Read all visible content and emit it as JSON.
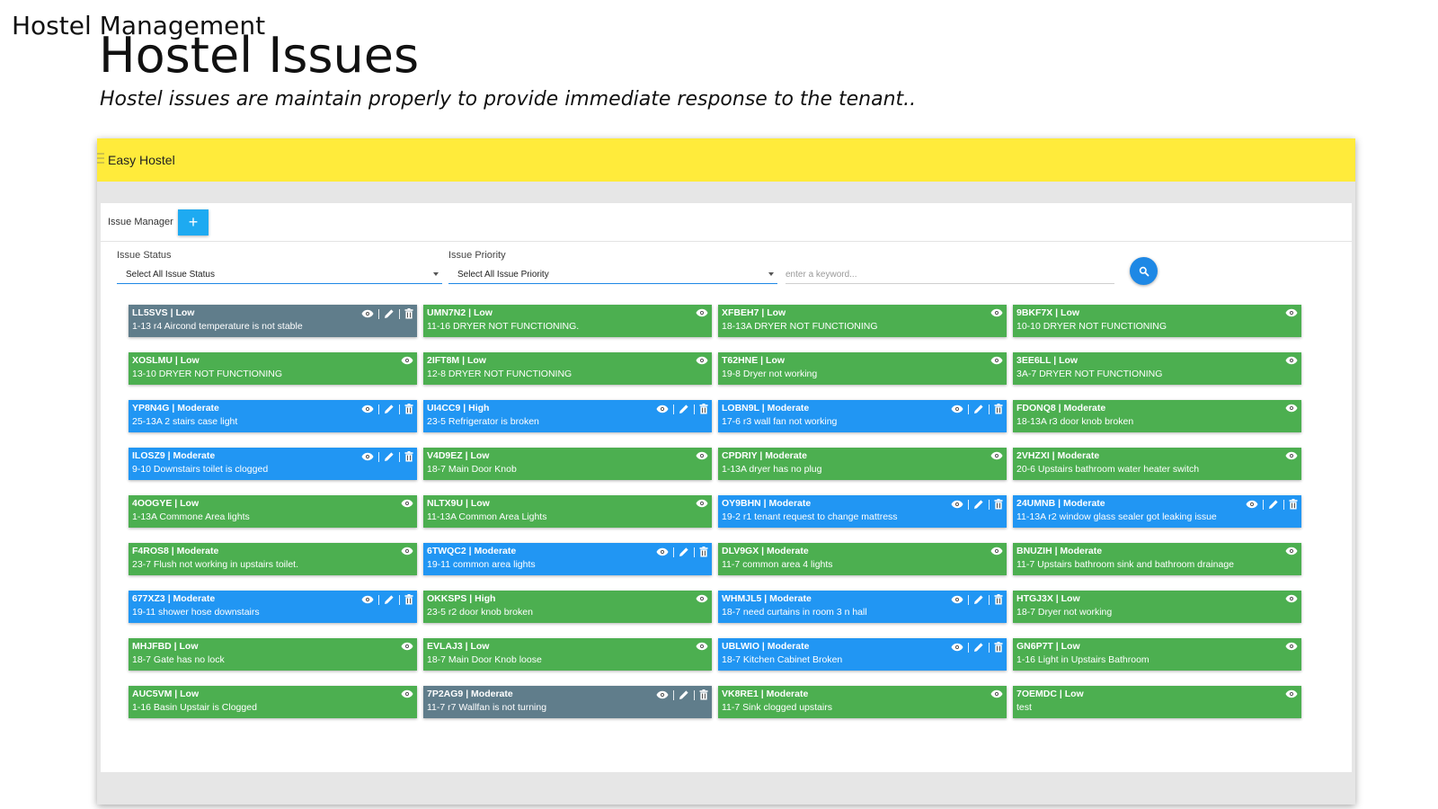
{
  "slide": {
    "kicker": "Hostel Management",
    "title": "Hostel Issues",
    "subtitle": "Hostel issues are maintain properly to provide immediate response to the tenant.."
  },
  "app": {
    "title": "Easy Hostel",
    "header_color": "#ffeb3b",
    "panel_label": "Issue Manager",
    "add_label": "+",
    "filters": {
      "status_label": "Issue Status",
      "status_value": "Select All Issue Status",
      "priority_label": "Issue Priority",
      "priority_value": "Select All Issue Priority",
      "keyword_placeholder": "enter a keyword..."
    }
  },
  "colors": {
    "low": "#4caf50",
    "moderate": "#2196f3",
    "grey": "#607d8b",
    "accent": "#1e88e5"
  },
  "issues": [
    {
      "head": "LL5SVS | Low",
      "desc": "1-13 r4 Aircond temperature is not stable",
      "color": "grey",
      "actions": [
        "eye",
        "edit",
        "delete"
      ]
    },
    {
      "head": "UMN7N2 | Low",
      "desc": "11-16 DRYER NOT FUNCTIONING.",
      "color": "low",
      "actions": [
        "eye"
      ]
    },
    {
      "head": "XFBEH7 | Low",
      "desc": "18-13A DRYER NOT FUNCTIONING",
      "color": "low",
      "actions": [
        "eye"
      ]
    },
    {
      "head": "9BKF7X | Low",
      "desc": "10-10 DRYER NOT FUNCTIONING",
      "color": "low",
      "actions": [
        "eye"
      ]
    },
    {
      "head": "XOSLMU | Low",
      "desc": "13-10 DRYER NOT FUNCTIONING",
      "color": "low",
      "actions": [
        "eye"
      ]
    },
    {
      "head": "2IFT8M | Low",
      "desc": "12-8 DRYER NOT FUNCTIONING",
      "color": "low",
      "actions": [
        "eye"
      ]
    },
    {
      "head": "T62HNE | Low",
      "desc": "19-8 Dryer not working",
      "color": "low",
      "actions": [
        "eye"
      ]
    },
    {
      "head": "3EE6LL | Low",
      "desc": "3A-7 DRYER NOT FUNCTIONING",
      "color": "low",
      "actions": [
        "eye"
      ]
    },
    {
      "head": "YP8N4G | Moderate",
      "desc": "25-13A 2 stairs case light",
      "color": "mod",
      "actions": [
        "eye",
        "edit",
        "delete"
      ]
    },
    {
      "head": "UI4CC9 | High",
      "desc": "23-5 Refrigerator is broken",
      "color": "mod",
      "actions": [
        "eye",
        "edit",
        "delete"
      ]
    },
    {
      "head": "LOBN9L | Moderate",
      "desc": "17-6 r3 wall fan not working",
      "color": "mod",
      "actions": [
        "eye",
        "edit",
        "delete"
      ]
    },
    {
      "head": "FDONQ8 | Moderate",
      "desc": "18-13A r3 door knob broken",
      "color": "low",
      "actions": [
        "eye"
      ]
    },
    {
      "head": "ILOSZ9 | Moderate",
      "desc": "9-10 Downstairs toilet is clogged",
      "color": "mod",
      "actions": [
        "eye",
        "edit",
        "delete"
      ]
    },
    {
      "head": "V4D9EZ | Low",
      "desc": "18-7 Main Door Knob",
      "color": "low",
      "actions": [
        "eye"
      ]
    },
    {
      "head": "CPDRIY | Moderate",
      "desc": "1-13A dryer has no plug",
      "color": "low",
      "actions": [
        "eye"
      ]
    },
    {
      "head": "2VHZXI | Moderate",
      "desc": "20-6 Upstairs bathroom water heater switch",
      "color": "low",
      "actions": [
        "eye"
      ]
    },
    {
      "head": "4OOGYE | Low",
      "desc": "1-13A Commone Area lights",
      "color": "low",
      "actions": [
        "eye"
      ]
    },
    {
      "head": "NLTX9U | Low",
      "desc": "11-13A Common Area Lights",
      "color": "low",
      "actions": [
        "eye"
      ]
    },
    {
      "head": "OY9BHN | Moderate",
      "desc": "19-2 r1 tenant request to change mattress",
      "color": "mod",
      "actions": [
        "eye",
        "edit",
        "delete"
      ]
    },
    {
      "head": "24UMNB | Moderate",
      "desc": "11-13A r2 window glass sealer got leaking issue",
      "color": "mod",
      "actions": [
        "eye",
        "edit",
        "delete"
      ]
    },
    {
      "head": "F4ROS8 | Moderate",
      "desc": "23-7 Flush not working in upstairs toilet.",
      "color": "low",
      "actions": [
        "eye"
      ]
    },
    {
      "head": "6TWQC2 | Moderate",
      "desc": "19-11 common area lights",
      "color": "mod",
      "actions": [
        "eye",
        "edit",
        "delete"
      ]
    },
    {
      "head": "DLV9GX | Moderate",
      "desc": "11-7 common area 4 lights",
      "color": "low",
      "actions": [
        "eye"
      ]
    },
    {
      "head": "BNUZIH | Moderate",
      "desc": "11-7 Upstairs bathroom sink and bathroom drainage",
      "color": "low",
      "actions": [
        "eye"
      ]
    },
    {
      "head": "677XZ3 | Moderate",
      "desc": "19-11 shower hose downstairs",
      "color": "mod",
      "actions": [
        "eye",
        "edit",
        "delete"
      ]
    },
    {
      "head": "OKKSPS | High",
      "desc": "23-5 r2 door knob broken",
      "color": "low",
      "actions": [
        "eye"
      ]
    },
    {
      "head": "WHMJL5 | Moderate",
      "desc": "18-7 need curtains in room 3 n hall",
      "color": "mod",
      "actions": [
        "eye",
        "edit",
        "delete"
      ]
    },
    {
      "head": "HTGJ3X | Low",
      "desc": "18-7 Dryer not working",
      "color": "low",
      "actions": [
        "eye"
      ]
    },
    {
      "head": "MHJFBD | Low",
      "desc": "18-7 Gate has no lock",
      "color": "low",
      "actions": [
        "eye"
      ]
    },
    {
      "head": "EVLAJ3 | Low",
      "desc": "18-7 Main Door Knob loose",
      "color": "low",
      "actions": [
        "eye"
      ]
    },
    {
      "head": "UBLWIO | Moderate",
      "desc": "18-7 Kitchen Cabinet Broken",
      "color": "mod",
      "actions": [
        "eye",
        "edit",
        "delete"
      ]
    },
    {
      "head": "GN6P7T | Low",
      "desc": "1-16 Light in Upstairs Bathroom",
      "color": "low",
      "actions": [
        "eye"
      ]
    },
    {
      "head": "AUC5VM | Low",
      "desc": "1-16 Basin Upstair is Clogged",
      "color": "low",
      "actions": [
        "eye"
      ]
    },
    {
      "head": "7P2AG9 | Moderate",
      "desc": "11-7 r7 Wallfan is not turning",
      "color": "grey",
      "actions": [
        "eye",
        "edit",
        "delete"
      ]
    },
    {
      "head": "VK8RE1 | Moderate",
      "desc": "11-7 Sink clogged upstairs",
      "color": "low",
      "actions": [
        "eye"
      ]
    },
    {
      "head": "7OEMDC | Low",
      "desc": "test",
      "color": "low",
      "actions": [
        "eye"
      ]
    }
  ]
}
